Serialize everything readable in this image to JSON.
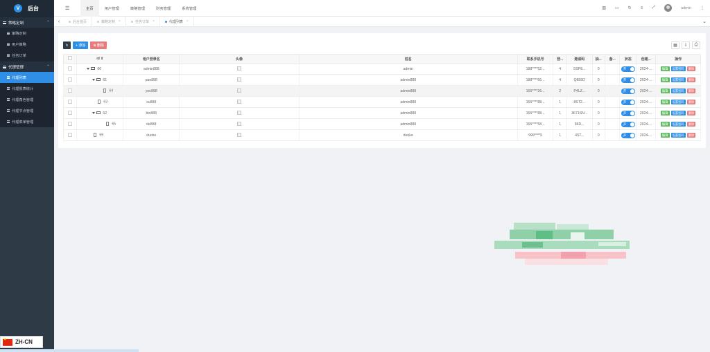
{
  "app": {
    "title": "后台",
    "logo_letter": "V"
  },
  "sidebar": {
    "groups": [
      {
        "label": "策略定制",
        "items": [
          "策略定制",
          "用户策略",
          "任务订单"
        ]
      },
      {
        "label": "代理管理",
        "items": [
          "代理列表",
          "代理报表统计",
          "代理角色管理",
          "代理节点管理",
          "代理菜单管理"
        ]
      }
    ],
    "active_item": "代理列表"
  },
  "topnav": {
    "items": [
      "主页",
      "用户管理",
      "策略管理",
      "财务管理",
      "系统管理"
    ],
    "active": "主页"
  },
  "user": {
    "name": "admin"
  },
  "tabs": [
    {
      "label": "后台首页",
      "active": false
    },
    {
      "label": "策略定制",
      "active": false
    },
    {
      "label": "任务订单",
      "active": false
    },
    {
      "label": "代理列表",
      "active": true
    }
  ],
  "toolbar": {
    "add_label": "添加",
    "delete_label": "删除"
  },
  "table": {
    "columns": [
      "id",
      "用户登录名",
      "头像",
      "姓名",
      "联系手机号",
      "登...",
      "邀请码",
      "抽...",
      "备...",
      "状态",
      "创建...",
      "操作"
    ],
    "rows": [
      {
        "id": "60",
        "login": "admin888",
        "name": "admin",
        "phone": "188****52...",
        "level": "4",
        "code": "SSP8...",
        "rate": "0",
        "date": "2024-...",
        "depth": 0,
        "type": "folder"
      },
      {
        "id": "61",
        "login": "pao888",
        "name": "admin888",
        "phone": "188****66...",
        "level": "4",
        "code": "Q855D",
        "rate": "0",
        "date": "2024-...",
        "depth": 1,
        "type": "folder"
      },
      {
        "id": "64",
        "login": "you888",
        "name": "admin888",
        "phone": "165****26...",
        "level": "2",
        "code": "P4LZ...",
        "rate": "0",
        "date": "2024-...",
        "depth": 2,
        "type": "file"
      },
      {
        "id": "63",
        "login": "xu888",
        "name": "admin888",
        "phone": "165****88...",
        "level": "1",
        "code": "8ST2...",
        "rate": "0",
        "date": "2024-...",
        "depth": 1,
        "type": "file"
      },
      {
        "id": "62",
        "login": "bin888",
        "name": "admin888",
        "phone": "165****88...",
        "level": "1",
        "code": "3671SN...",
        "rate": "0",
        "date": "2024-...",
        "depth": 1,
        "type": "folder"
      },
      {
        "id": "65",
        "login": "de888",
        "name": "admin888",
        "phone": "165****58...",
        "level": "1",
        "code": "86D...",
        "rate": "0",
        "date": "2024-...",
        "depth": 2,
        "type": "file"
      },
      {
        "id": "59",
        "login": "duoke",
        "name": "duoke",
        "phone": "999****9",
        "level": "1",
        "code": "4ST...",
        "rate": "0",
        "date": "2024-...",
        "depth": 0,
        "type": "file"
      }
    ],
    "status_label": "开",
    "actions": {
      "edit": "编辑",
      "pwd": "设置密码",
      "delete": "删除"
    }
  },
  "language": {
    "code": "ZH-CN"
  }
}
